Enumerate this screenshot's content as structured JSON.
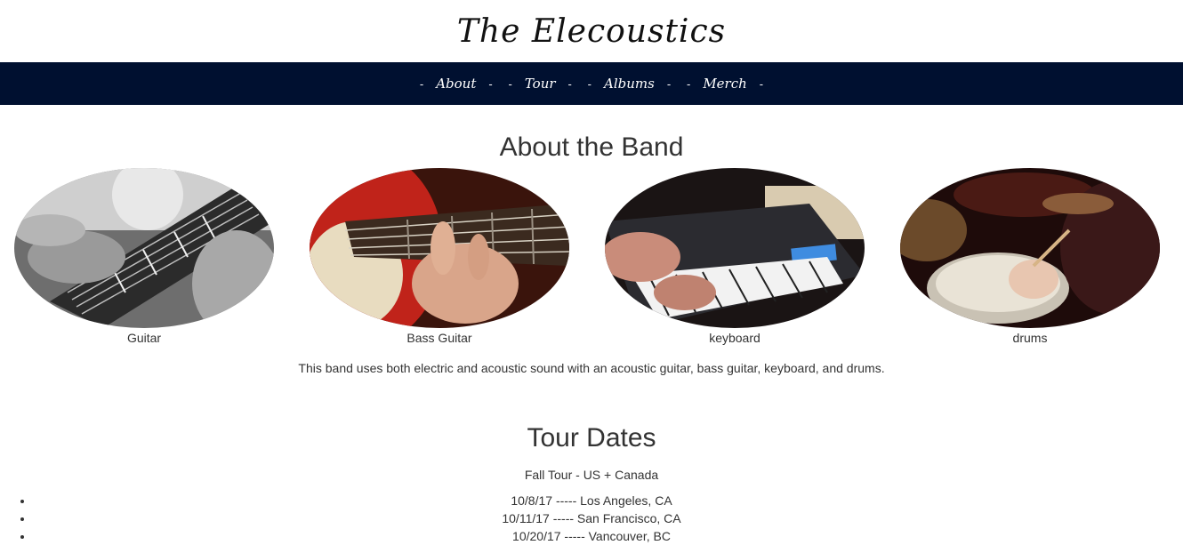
{
  "header": {
    "title": "The Elecoustics"
  },
  "nav": {
    "items": [
      {
        "label": "About"
      },
      {
        "label": "Tour"
      },
      {
        "label": "Albums"
      },
      {
        "label": "Merch"
      }
    ],
    "dash": "-"
  },
  "about": {
    "title": "About the Band",
    "instruments": [
      {
        "label": "Guitar"
      },
      {
        "label": "Bass Guitar"
      },
      {
        "label": "keyboard"
      },
      {
        "label": "drums"
      }
    ],
    "description": "This band uses both electric and acoustic sound with an acoustic guitar, bass guitar, keyboard, and drums."
  },
  "tour": {
    "title": "Tour Dates",
    "subtitle": "Fall Tour - US + Canada",
    "dates": [
      "10/8/17 ----- Los Angeles, CA",
      "10/11/17 ----- San Francisco, CA",
      "10/20/17 ----- Vancouver, BC"
    ]
  },
  "colors": {
    "nav_bg": "#001030",
    "nav_text": "#ffffff",
    "text": "#333333"
  }
}
